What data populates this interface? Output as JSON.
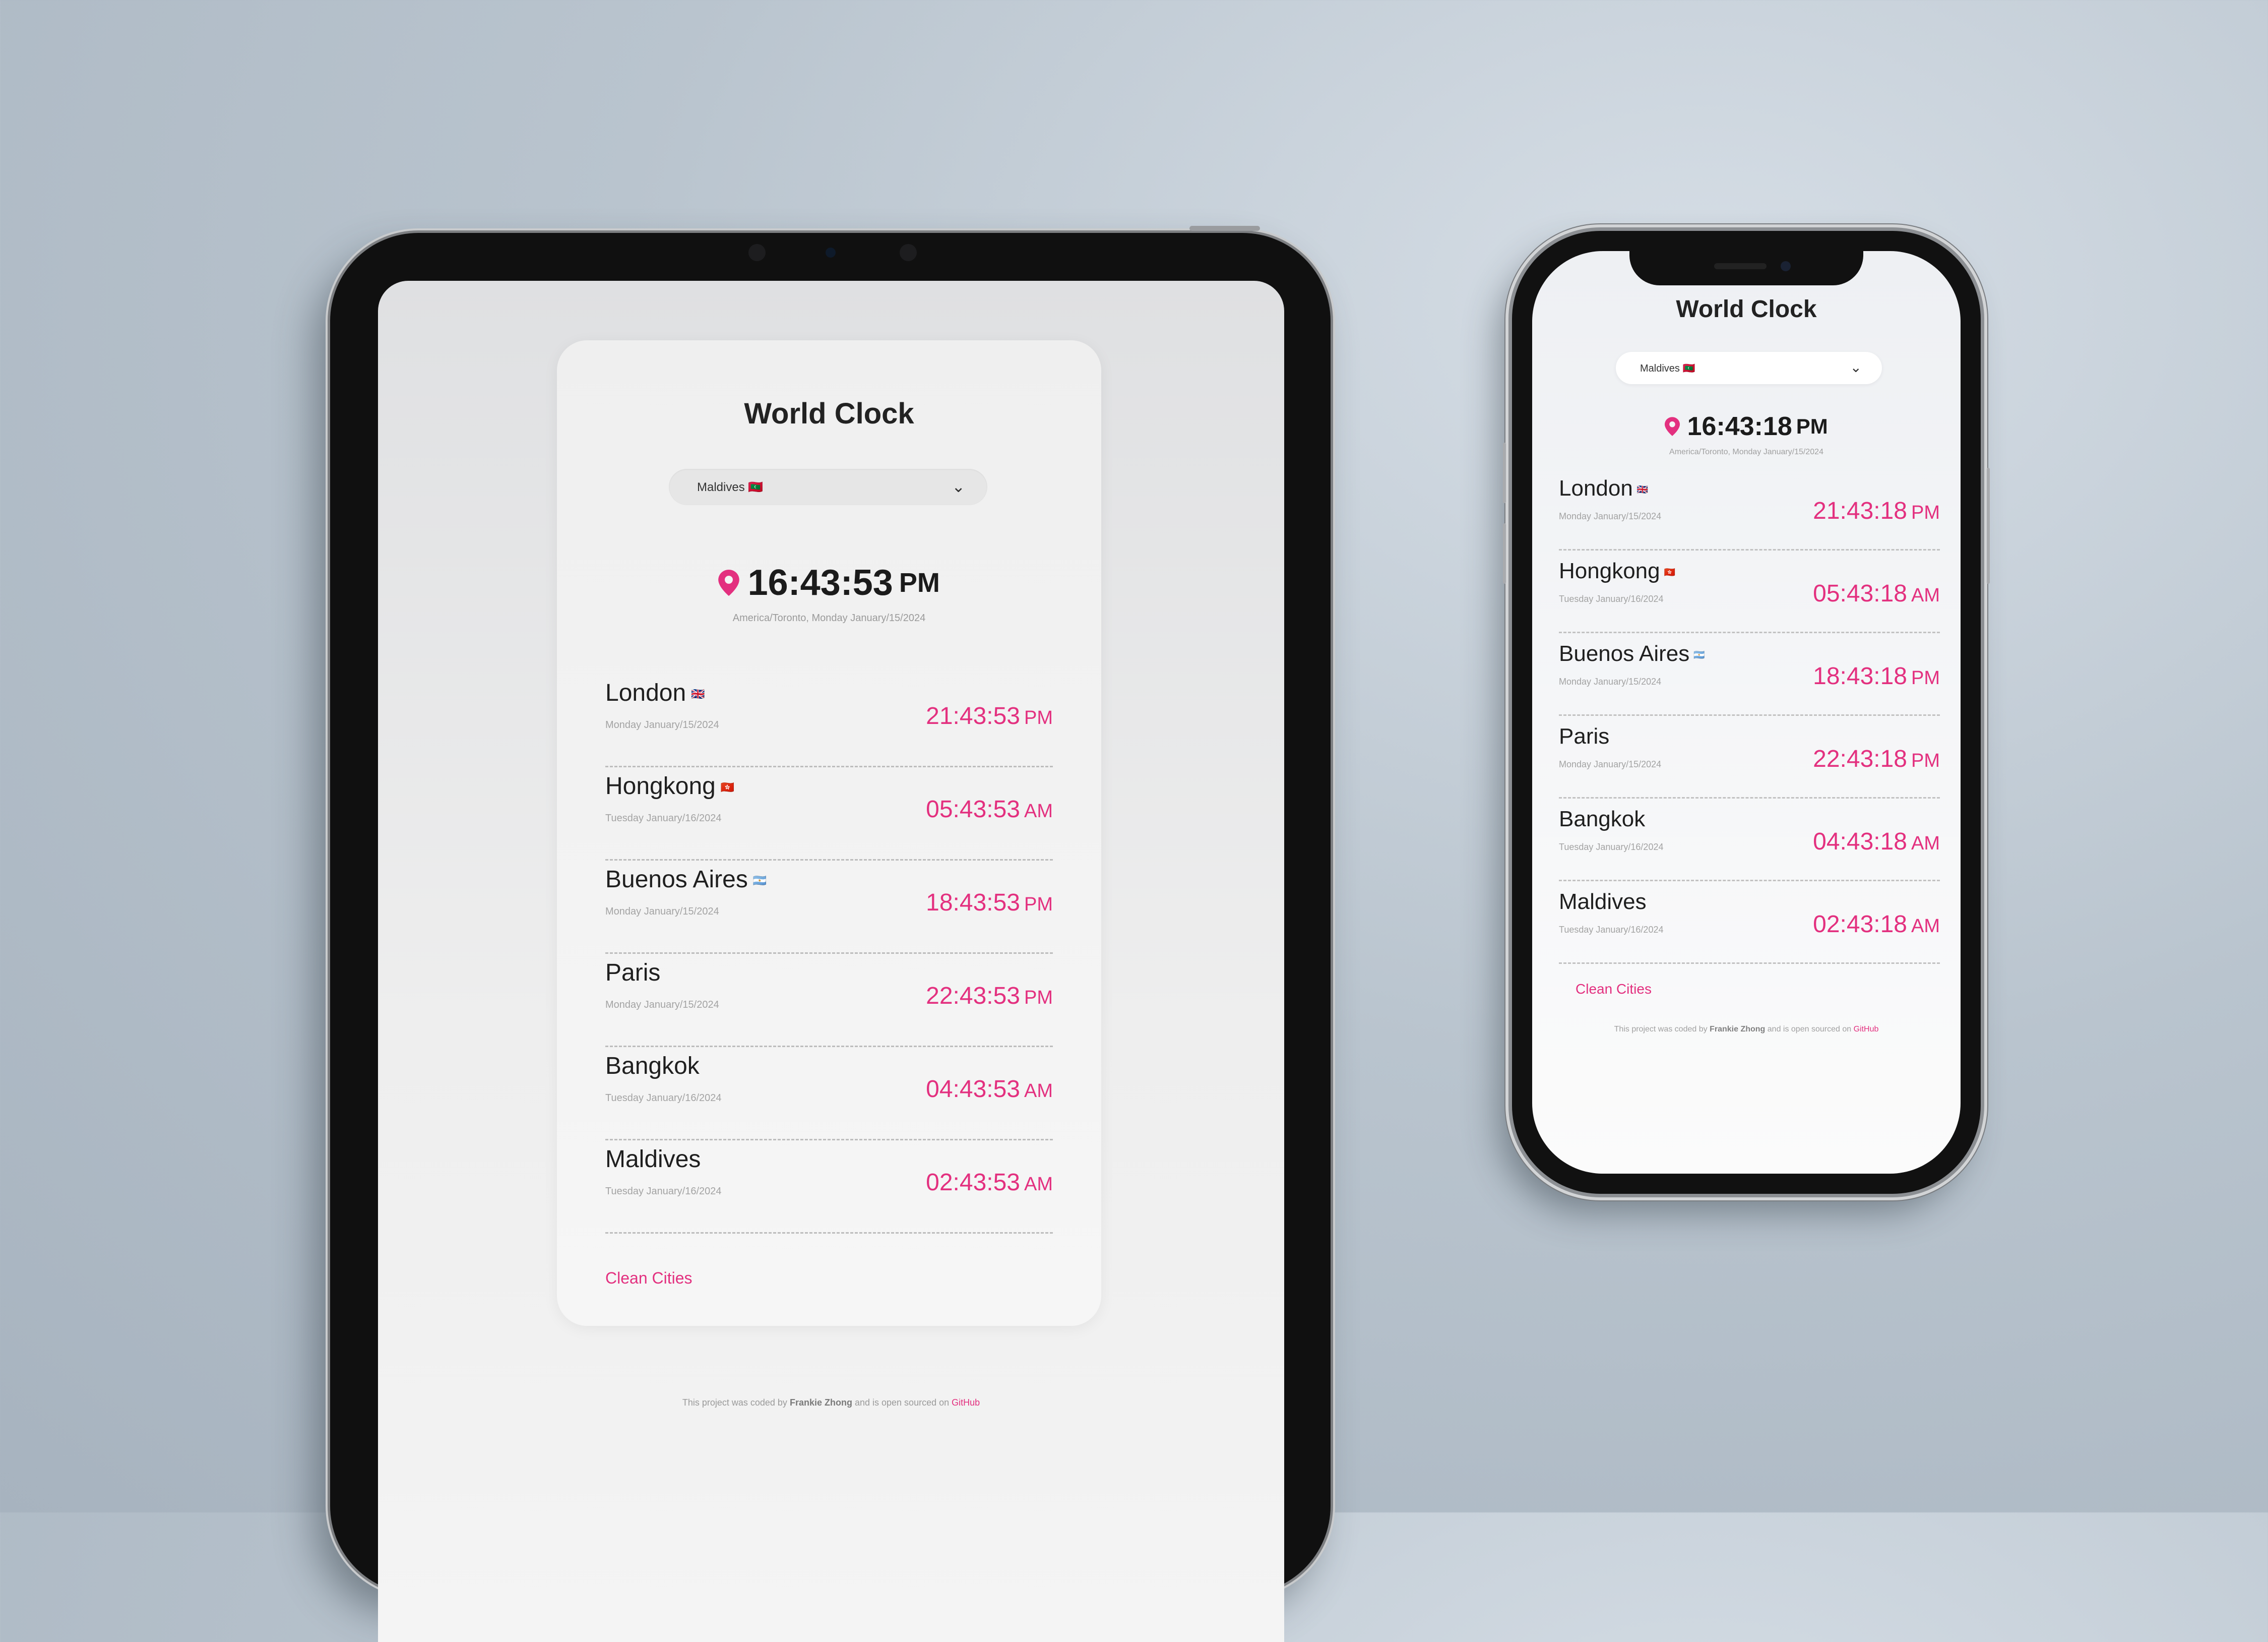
{
  "app": {
    "title": "World Clock",
    "selected_city": "Maldives 🇲🇻",
    "clean_label": "Clean Cities",
    "footer": {
      "prefix": "This project was coded by",
      "author": "Frankie Zhong",
      "middle": "and is open sourced on",
      "link": "GitHub"
    }
  },
  "tablet": {
    "local_time": "16:43:53",
    "local_ampm": "PM",
    "local_sub": "America/Toronto, Monday January/15/2024",
    "cities": [
      {
        "name": "London",
        "flag": "🇬🇧",
        "date": "Monday January/15/2024",
        "time": "21:43:53",
        "ampm": "PM"
      },
      {
        "name": "Hongkong",
        "flag": "🇭🇰",
        "date": "Tuesday January/16/2024",
        "time": "05:43:53",
        "ampm": "AM"
      },
      {
        "name": "Buenos Aires",
        "flag": "🇦🇷",
        "date": "Monday January/15/2024",
        "time": "18:43:53",
        "ampm": "PM"
      },
      {
        "name": "Paris",
        "flag": "",
        "date": "Monday January/15/2024",
        "time": "22:43:53",
        "ampm": "PM"
      },
      {
        "name": "Bangkok",
        "flag": "",
        "date": "Tuesday January/16/2024",
        "time": "04:43:53",
        "ampm": "AM"
      },
      {
        "name": "Maldives",
        "flag": "",
        "date": "Tuesday January/16/2024",
        "time": "02:43:53",
        "ampm": "AM"
      }
    ]
  },
  "phone": {
    "local_time": "16:43:18",
    "local_ampm": "PM",
    "local_sub": "America/Toronto, Monday January/15/2024",
    "cities": [
      {
        "name": "London",
        "flag": "🇬🇧",
        "date": "Monday January/15/2024",
        "time": "21:43:18",
        "ampm": "PM"
      },
      {
        "name": "Hongkong",
        "flag": "🇭🇰",
        "date": "Tuesday January/16/2024",
        "time": "05:43:18",
        "ampm": "AM"
      },
      {
        "name": "Buenos Aires",
        "flag": "🇦🇷",
        "date": "Monday January/15/2024",
        "time": "18:43:18",
        "ampm": "PM"
      },
      {
        "name": "Paris",
        "flag": "",
        "date": "Monday January/15/2024",
        "time": "22:43:18",
        "ampm": "PM"
      },
      {
        "name": "Bangkok",
        "flag": "",
        "date": "Tuesday January/16/2024",
        "time": "04:43:18",
        "ampm": "AM"
      },
      {
        "name": "Maldives",
        "flag": "",
        "date": "Tuesday January/16/2024",
        "time": "02:43:18",
        "ampm": "AM"
      }
    ]
  },
  "icons": {
    "location": "location-pin-icon",
    "dropdown": "chevron-down-icon"
  },
  "colors": {
    "accent": "#e3307f",
    "text": "#1f1f1f",
    "muted": "#a3a3a3"
  }
}
